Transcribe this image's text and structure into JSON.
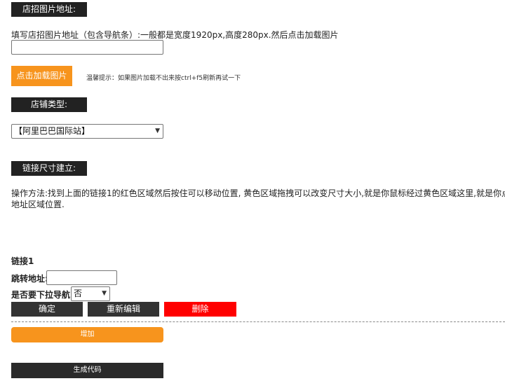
{
  "banner_section": {
    "tag": "店招图片地址:",
    "instruction": "填写店招图片地址（包含导航条）:一般都是宽度1920px,高度280px.然后点击加载图片",
    "url_value": "",
    "load_button": "点击加载图片",
    "tip": "温馨提示：如果图片加载不出来按ctrl+f5刷新再试一下"
  },
  "shop_type_section": {
    "tag": "店铺类型:",
    "selected": "【阿里巴巴国际站】"
  },
  "link_size_section": {
    "tag": "链接尺寸建立:",
    "instructions": "操作方法:找到上面的链接1的红色区域然后按住可以移动位置, 黄色区域拖拽可以改变尺寸大小,就是你鼠标经过黄色区域这里,就是你点击跳转的",
    "instructions_line2": "地址区域位置."
  },
  "link1": {
    "title": "链接1",
    "jump_label": "跳转地址:",
    "jump_value": "",
    "dropdown_label": "是否要下拉导航:",
    "dropdown_selected": "否",
    "confirm": "确定",
    "re_edit": "重新编辑",
    "delete": "删除"
  },
  "actions": {
    "add": "增加",
    "generate": "生成代码"
  },
  "colors": {
    "dark": "#222222",
    "orange": "#f7941d",
    "red": "#ff0000"
  }
}
